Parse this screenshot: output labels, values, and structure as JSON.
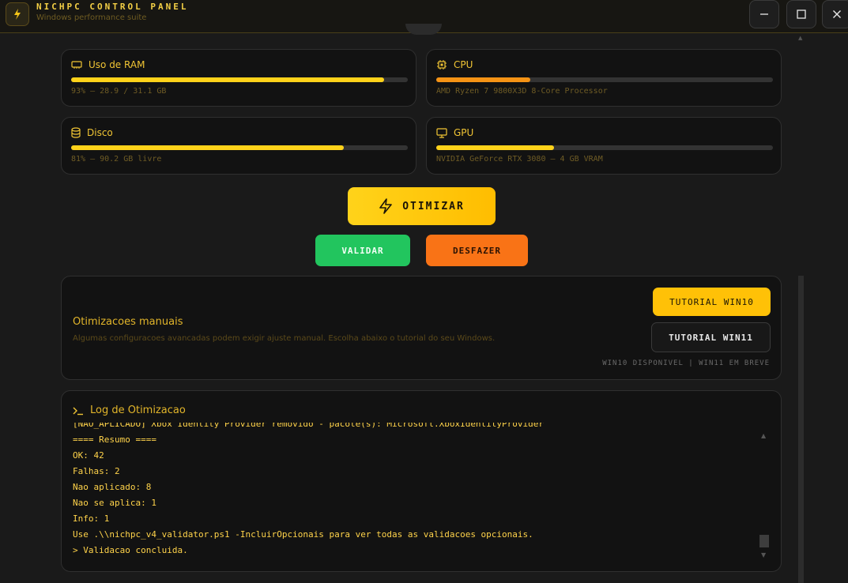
{
  "window": {
    "title": "NICHPC CONTROL PANEL",
    "subtitle": "Windows performance suite",
    "controls": {
      "minimize": "minimize-icon",
      "maximize": "maximize-icon",
      "close": "close-icon"
    }
  },
  "stats": [
    {
      "label": "Uso de RAM",
      "icon": "memory-icon",
      "info": "93% — 28.9 / 31.1 GB",
      "level": 0.93,
      "color": "#ffd21a"
    },
    {
      "label": "CPU",
      "icon": "cpu-icon",
      "info": "AMD Ryzen 7 9800X3D 8-Core Processor",
      "level": 0.28,
      "color": "#f59315"
    },
    {
      "label": "Disco",
      "icon": "disk-icon",
      "info": "81% — 90.2 GB livre",
      "level": 0.81,
      "color": "#ffd21a"
    },
    {
      "label": "GPU",
      "icon": "monitor-icon",
      "info": "NVIDIA GeForce RTX 3080 — 4 GB VRAM",
      "level": 0.35,
      "color": "#ffd21a"
    }
  ],
  "actions": {
    "optimize": "OTIMIZAR",
    "validate": "VALIDAR",
    "undo": "DESFAZER"
  },
  "manual": {
    "title": "Otimizacoes manuais",
    "description": "Algumas configuracoes avancadas podem exigir ajuste manual. Escolha abaixo o tutorial do seu Windows.",
    "tutorial_win10": "TUTORIAL WIN10",
    "tutorial_win11": "TUTORIAL WIN11",
    "availability": "WIN10 DISPONIVEL | WIN11 EM BREVE"
  },
  "log": {
    "title": "Log de Otimizacao",
    "lines": [
      "[NAO_APLICADO] Xbox Identity Provider removido - pacote(s): Microsoft.XboxIdentityProvider",
      "==== Resumo ====",
      "OK: 42",
      "Falhas: 2",
      "Nao aplicado: 8",
      "Nao se aplica: 1",
      "Info: 1",
      "Use .\\\\nichpc_v4_validator.ps1 -IncluirOpcionais para ver todas as validacoes opcionais.",
      "> Validacao concluida."
    ]
  }
}
